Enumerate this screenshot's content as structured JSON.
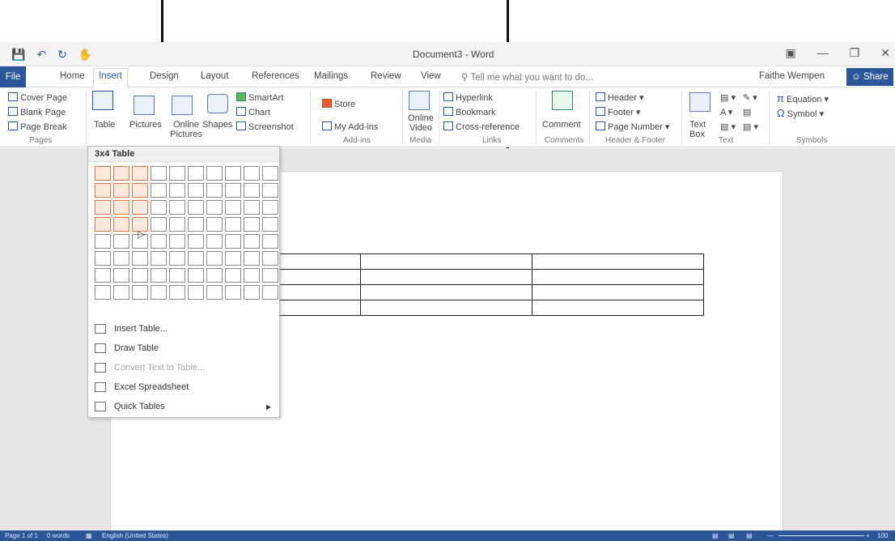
{
  "window": {
    "title": "Document3 - Word"
  },
  "quick_access": [
    "save-icon",
    "undo-icon",
    "redo-icon",
    "touch-icon"
  ],
  "window_controls": [
    "ribbon-display-icon",
    "minimize-icon",
    "restore-icon",
    "close-icon"
  ],
  "tabs": {
    "file": "File",
    "home": "Home",
    "insert": "Insert",
    "design": "Design",
    "layout": "Layout",
    "references": "References",
    "mailings": "Mailings",
    "review": "Review",
    "view": "View",
    "tell_me": "Tell me what you want to do...",
    "user": "Faithe Wempen",
    "share": "Share"
  },
  "ribbon": {
    "pages": {
      "cover_page": "Cover Page",
      "blank_page": "Blank Page",
      "page_break": "Page Break",
      "group": "Pages"
    },
    "tables": {
      "table": "Table"
    },
    "illustrations": {
      "pictures": "Pictures",
      "online_pictures": "Online Pictures",
      "shapes": "Shapes",
      "smartart": "SmartArt",
      "chart": "Chart",
      "screenshot": "Screenshot"
    },
    "addins": {
      "store": "Store",
      "my_addins": "My Add-ins",
      "group": "Add-ins"
    },
    "media": {
      "online_video": "Online Video",
      "group": "Media"
    },
    "links": {
      "hyperlink": "Hyperlink",
      "bookmark": "Bookmark",
      "cross_reference": "Cross-reference",
      "group": "Links"
    },
    "comments": {
      "comment": "Comment",
      "group": "Comments"
    },
    "header_footer": {
      "header": "Header",
      "footer": "Footer",
      "page_number": "Page Number",
      "group": "Header & Footer"
    },
    "text": {
      "text_box": "Text Box",
      "group": "Text"
    },
    "symbols": {
      "equation": "Equation",
      "symbol": "Symbol",
      "group": "Symbols"
    }
  },
  "table_dropdown": {
    "header": "3x4 Table",
    "grid_cols": 10,
    "grid_rows": 8,
    "selected_cols": 3,
    "selected_rows": 4,
    "menu": [
      {
        "label": "Insert Table...",
        "enabled": true
      },
      {
        "label": "Draw Table",
        "enabled": true
      },
      {
        "label": "Convert Text to Table...",
        "enabled": false
      },
      {
        "label": "Excel Spreadsheet",
        "enabled": true
      },
      {
        "label": "Quick Tables",
        "enabled": true,
        "submenu": true
      }
    ]
  },
  "document_table": {
    "rows": 4,
    "cols": 3
  },
  "status": {
    "page": "Page 1 of 1",
    "words": "0 words",
    "language": "English (United States)",
    "zoom": "100"
  },
  "colors": {
    "accent": "#2b579a",
    "selection": "#e07a44"
  }
}
